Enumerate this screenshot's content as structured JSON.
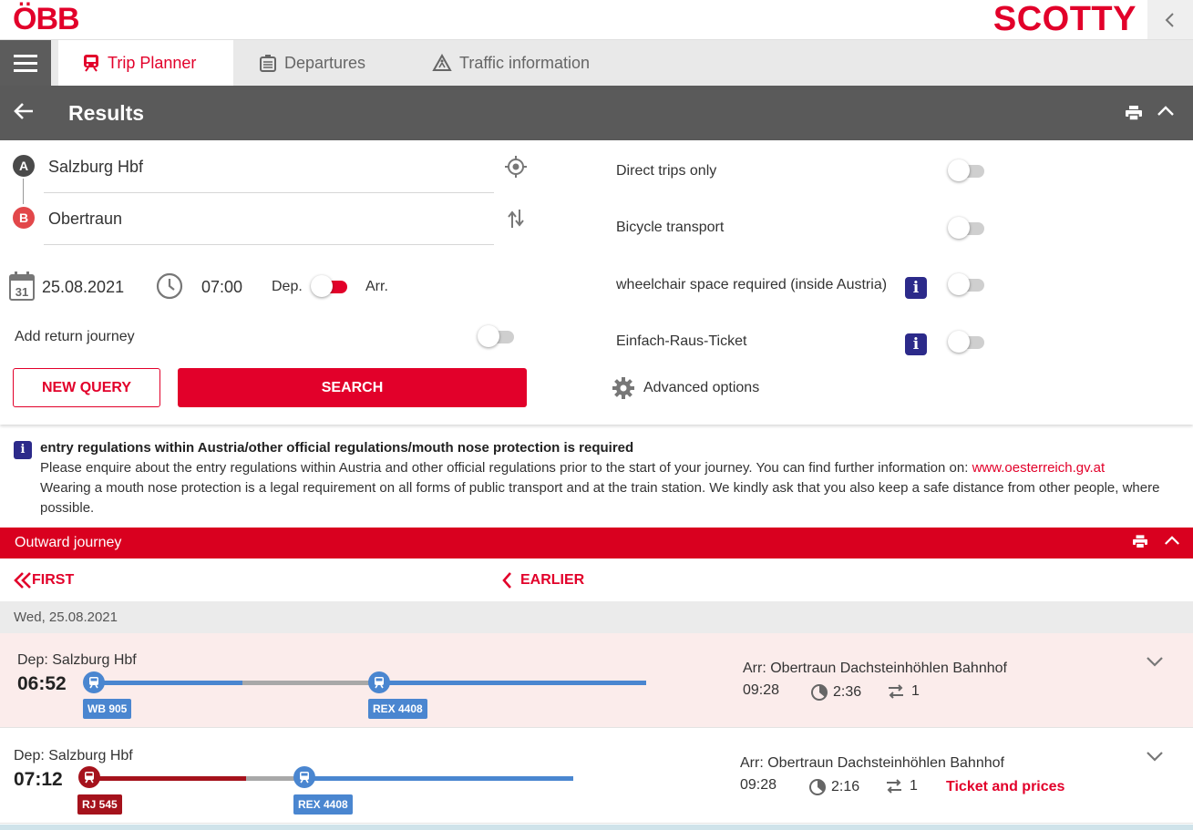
{
  "brand": {
    "logo": "ÖBB",
    "app": "SCOTTY",
    "accent": "#e2002a"
  },
  "tabs": [
    {
      "label": "Trip Planner",
      "icon": "train-icon",
      "active": true
    },
    {
      "label": "Departures",
      "icon": "departure-board-icon",
      "active": false
    },
    {
      "label": "Traffic information",
      "icon": "construction-icon",
      "active": false
    }
  ],
  "results": {
    "title": "Results"
  },
  "form": {
    "from": {
      "marker": "A",
      "value": "Salzburg Hbf"
    },
    "to": {
      "marker": "B",
      "value": "Obertraun"
    },
    "date": "25.08.2021",
    "calendar_day": "31",
    "time": "07:00",
    "dep_label": "Dep.",
    "arr_label": "Arr.",
    "return_label": "Add return journey",
    "new_query": "NEW QUERY",
    "search": "SEARCH"
  },
  "options": [
    {
      "label": "Direct trips only",
      "info": false,
      "on": false
    },
    {
      "label": "Bicycle transport",
      "info": false,
      "on": false
    },
    {
      "label": "wheelchair space required (inside Austria)",
      "info": true,
      "on": false
    },
    {
      "label": "Einfach-Raus-Ticket",
      "info": true,
      "on": false
    }
  ],
  "advanced": "Advanced options",
  "notice": {
    "title": "entry regulations within Austria/other official regulations/mouth nose protection is required",
    "line1": "Please enquire about the entry regulations within Austria and other official regulations prior to the start of your journey. You can find further information on: ",
    "link": "www.oesterreich.gv.at",
    "line2": "Wearing a mouth nose protection is a legal requirement on all forms of public transport and at the train station. We kindly ask that you also keep a safe distance from other people, where possible."
  },
  "outward": {
    "label": "Outward journey"
  },
  "paging": {
    "first": "FIRST",
    "earlier": "EARLIER"
  },
  "date_header": "Wed, 25.08.2021",
  "trips": [
    {
      "dep_label": "Dep: Salzburg Hbf",
      "dep_time": "06:52",
      "arr_label": "Arr: Obertraun Dachsteinhöhlen Bahnhof",
      "arr_time": "09:28",
      "duration": "2:36",
      "changes": "1",
      "trains": [
        "WB 905",
        "REX 4408"
      ],
      "ticket": ""
    },
    {
      "dep_label": "Dep: Salzburg Hbf",
      "dep_time": "07:12",
      "arr_label": "Arr: Obertraun Dachsteinhöhlen Bahnhof",
      "arr_time": "09:28",
      "duration": "2:16",
      "changes": "1",
      "trains": [
        "RJ 545",
        "REX 4408"
      ],
      "ticket": "Ticket and prices"
    }
  ],
  "colors": {
    "regional_blue": "#4a86d0",
    "railjet_red": "#a5121c",
    "walk_gray": "#a8a8a8"
  }
}
